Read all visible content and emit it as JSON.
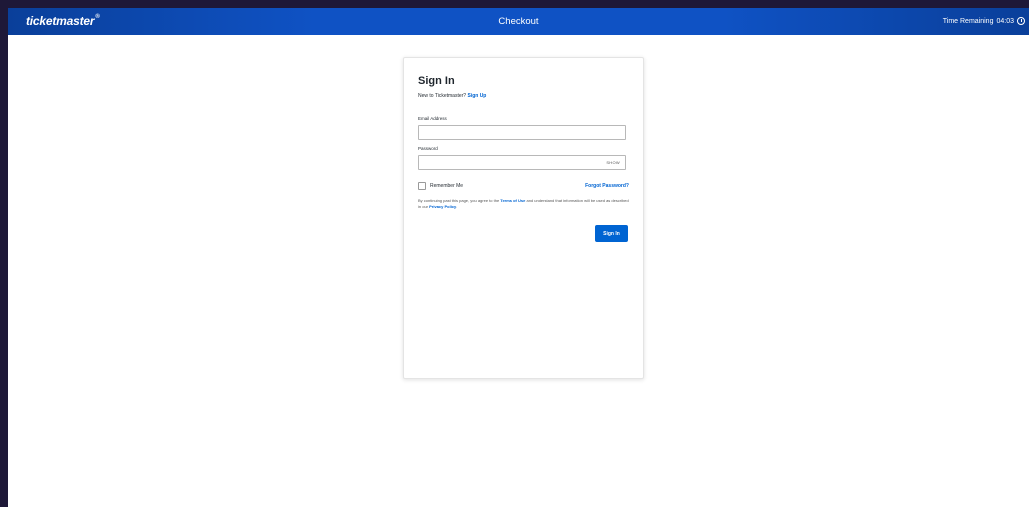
{
  "header": {
    "logo": "ticketmaster",
    "logo_mark": "®",
    "title": "Checkout",
    "timer_label": "Time Remaining",
    "timer_value": "04:03"
  },
  "signin": {
    "title": "Sign In",
    "new_prefix": "New to Ticketmaster?",
    "signup_link": "Sign Up",
    "email_label": "Email Address",
    "email_value": "",
    "password_label": "Password",
    "password_value": "",
    "show_label": "SHOW",
    "remember_label": "Remember Me",
    "forgot_link": "Forgot Password?",
    "terms_prefix": "By continuing past this page, you agree to the",
    "terms_link": "Terms of Use",
    "terms_middle": "and understand that information will be used as described in our",
    "privacy_link": "Privacy Policy",
    "terms_suffix": ".",
    "submit_label": "Sign In"
  },
  "colors": {
    "header_bg": "#0f52c4",
    "accent": "#0064d2",
    "frame": "#1e1838"
  },
  "icons": {
    "timer": "clock-icon"
  }
}
